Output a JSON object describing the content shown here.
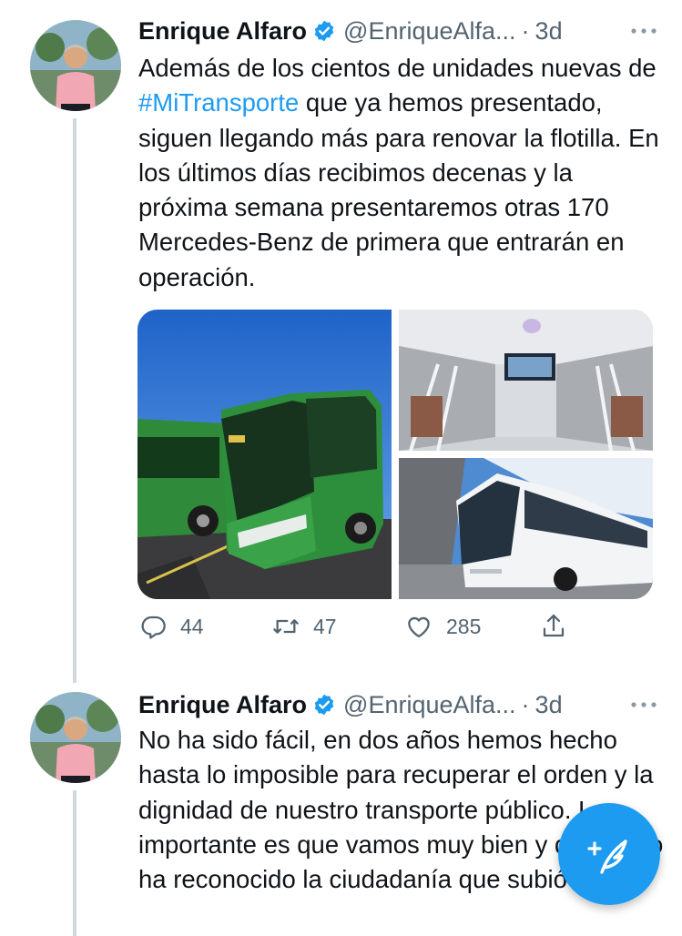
{
  "tweets": [
    {
      "author_name": "Enrique Alfaro",
      "handle": "@EnriqueAlfa...",
      "separator": "·",
      "time": "3d",
      "text_parts": [
        "Además de los cientos de unidades nuevas de ",
        "#MiTransporte",
        " que ya hemos presentado, siguen llegando más para renovar la flotilla. En los últimos días recibimos decenas y la próxima semana presentaremos otras 170 Mercedes-Benz de primera que entrarán en operación."
      ],
      "reply_count": "44",
      "retweet_count": "47",
      "like_count": "285"
    },
    {
      "author_name": "Enrique Alfaro",
      "handle": "@EnriqueAlfa...",
      "separator": "·",
      "time": "3d",
      "text": "No ha sido fácil, en dos años hemos hecho hasta lo imposible para recuperar el orden y la dignidad de nuestro transporte público. Lo importante es que vamos muy bien y que así lo ha reconocido la ciudadanía que subió su"
    }
  ],
  "colors": {
    "accent": "#1d9bf0",
    "secondary_text": "#536471",
    "thread_line": "#cfd9de"
  },
  "icons": {
    "verified": "verified-badge-icon",
    "more": "more-dots-icon",
    "reply": "reply-icon",
    "retweet": "retweet-icon",
    "like": "heart-icon",
    "share": "share-icon",
    "compose": "compose-tweet-icon"
  }
}
